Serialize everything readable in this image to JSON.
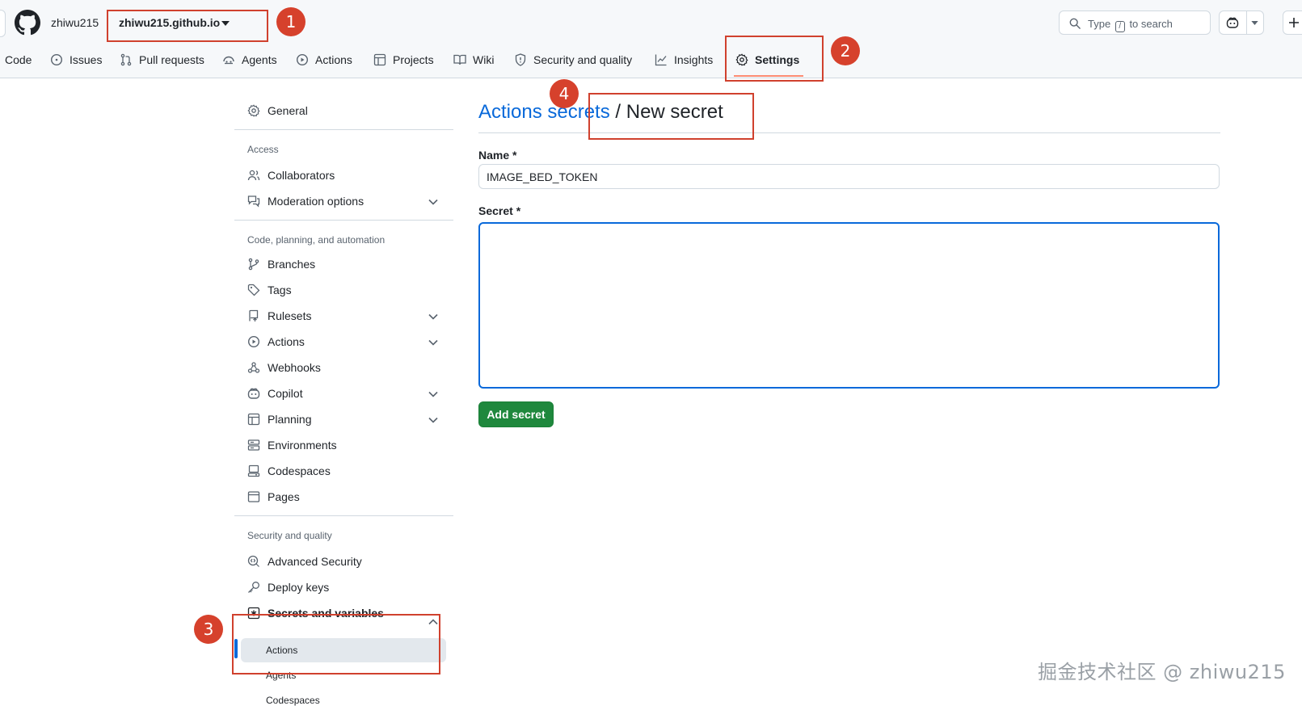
{
  "header": {
    "owner": "zhiwu215",
    "repo": "zhiwu215.github.io",
    "search_prefix": "Type",
    "search_key": "/",
    "search_suffix": "to search"
  },
  "tabs": [
    {
      "label": "Code",
      "icon": "code-icon"
    },
    {
      "label": "Issues",
      "icon": "issue-icon"
    },
    {
      "label": "Pull requests",
      "icon": "pull-request-icon"
    },
    {
      "label": "Agents",
      "icon": "agents-icon"
    },
    {
      "label": "Actions",
      "icon": "play-icon"
    },
    {
      "label": "Projects",
      "icon": "table-icon"
    },
    {
      "label": "Wiki",
      "icon": "book-icon"
    },
    {
      "label": "Security and quality",
      "icon": "shield-icon"
    },
    {
      "label": "Insights",
      "icon": "graph-icon"
    },
    {
      "label": "Settings",
      "icon": "gear-icon",
      "active": true
    }
  ],
  "sidebar": {
    "general": "General",
    "access_heading": "Access",
    "access": [
      "Collaborators",
      "Moderation options"
    ],
    "code_heading": "Code, planning, and automation",
    "code": [
      "Branches",
      "Tags",
      "Rulesets",
      "Actions",
      "Webhooks",
      "Copilot",
      "Planning",
      "Environments",
      "Codespaces",
      "Pages"
    ],
    "security_heading": "Security and quality",
    "security": [
      "Advanced Security",
      "Deploy keys",
      "Secrets and variables"
    ],
    "secrets_sub": [
      "Actions",
      "Agents",
      "Codespaces"
    ]
  },
  "main": {
    "breadcrumb_link": "Actions secrets",
    "breadcrumb_sep": " / ",
    "breadcrumb_current": "New secret",
    "name_label": "Name *",
    "name_value": "IMAGE_BED_TOKEN",
    "secret_label": "Secret *",
    "secret_value": "",
    "submit_label": "Add secret"
  },
  "annotations": [
    "1",
    "2",
    "3",
    "4"
  ],
  "watermark": "掘金技术社区 @ zhiwu215",
  "colors": {
    "accent": "#0969da",
    "primary_button": "#1f883d",
    "annotation_red": "#d0412e",
    "active_tab_underline": "#fd8c73"
  }
}
